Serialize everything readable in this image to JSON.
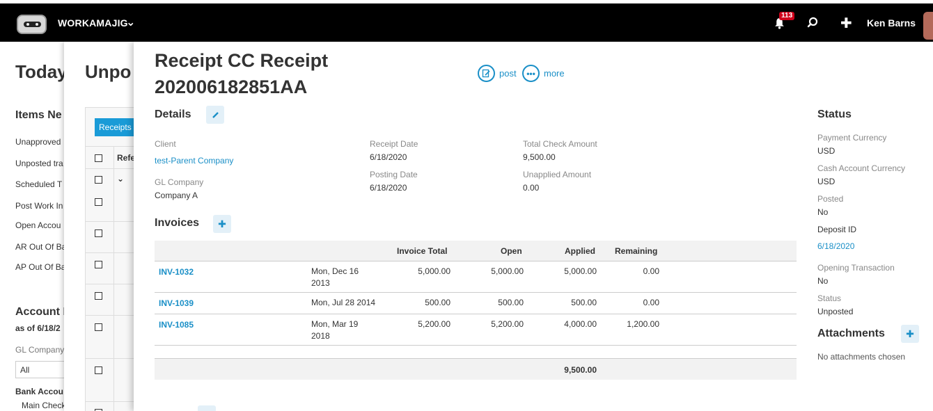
{
  "topbar": {
    "brand": "WORKAMAJIG",
    "notification_count": "113",
    "user_name": "Ken Barns"
  },
  "background_page": {
    "title": "Today",
    "items_heading": "Items Ne",
    "items": [
      "Unapproved",
      "Unposted tra",
      "Scheduled T",
      "Post Work In",
      "Open Accou",
      "AR Out Of Ba",
      "AP Out Of Ba"
    ],
    "account_heading": "Account B",
    "as_of": "as of 6/18/2",
    "gl_company_label": "GL Company",
    "gl_company_value": "All",
    "bank_accounts": "Bank Accou",
    "main_checking": "Main Check"
  },
  "middle_page": {
    "title": "Unpo",
    "tab_label": "Receipts",
    "col_header": "Refe"
  },
  "panel": {
    "title": "Receipt CC Receipt 202006182851AA",
    "actions": {
      "post": "post",
      "more": "more"
    },
    "details": {
      "heading": "Details",
      "client_label": "Client",
      "client_value": "test-Parent Company",
      "gl_company_label": "GL Company",
      "gl_company_value": "Company A",
      "receipt_date_label": "Receipt Date",
      "receipt_date_value": "6/18/2020",
      "posting_date_label": "Posting Date",
      "posting_date_value": "6/18/2020",
      "total_check_label": "Total Check Amount",
      "total_check_value": "9,500.00",
      "unapplied_label": "Unapplied Amount",
      "unapplied_value": "0.00"
    },
    "invoices": {
      "heading": "Invoices",
      "columns": {
        "invoice_total": "Invoice Total",
        "open": "Open",
        "applied": "Applied",
        "remaining": "Remaining"
      },
      "rows": [
        {
          "number": "INV-1032",
          "date_line1": "Mon, Dec 16",
          "date_line2": "2013",
          "total": "5,000.00",
          "open": "5,000.00",
          "applied": "5,000.00",
          "remaining": "0.00"
        },
        {
          "number": "INV-1039",
          "date_line1": "Mon, Jul 28 2014",
          "date_line2": "",
          "total": "500.00",
          "open": "500.00",
          "applied": "500.00",
          "remaining": "0.00"
        },
        {
          "number": "INV-1085",
          "date_line1": "Mon, Mar 19",
          "date_line2": "2018",
          "total": "5,200.00",
          "open": "5,200.00",
          "applied": "4,000.00",
          "remaining": "1,200.00"
        }
      ],
      "applied_total": "9,500.00"
    },
    "status": {
      "heading": "Status",
      "payment_currency_label": "Payment Currency",
      "payment_currency_value": "USD",
      "cash_account_currency_label": "Cash Account Currency",
      "cash_account_currency_value": "USD",
      "posted_label": "Posted",
      "posted_value": "No",
      "deposit_id_label": "Deposit ID",
      "deposit_id_value": "6/18/2020",
      "opening_label": "Opening Transaction",
      "opening_value": "No",
      "status_label": "Status",
      "status_value": "Unposted"
    },
    "attachments": {
      "heading": "Attachments",
      "empty_text": "No attachments chosen"
    }
  }
}
